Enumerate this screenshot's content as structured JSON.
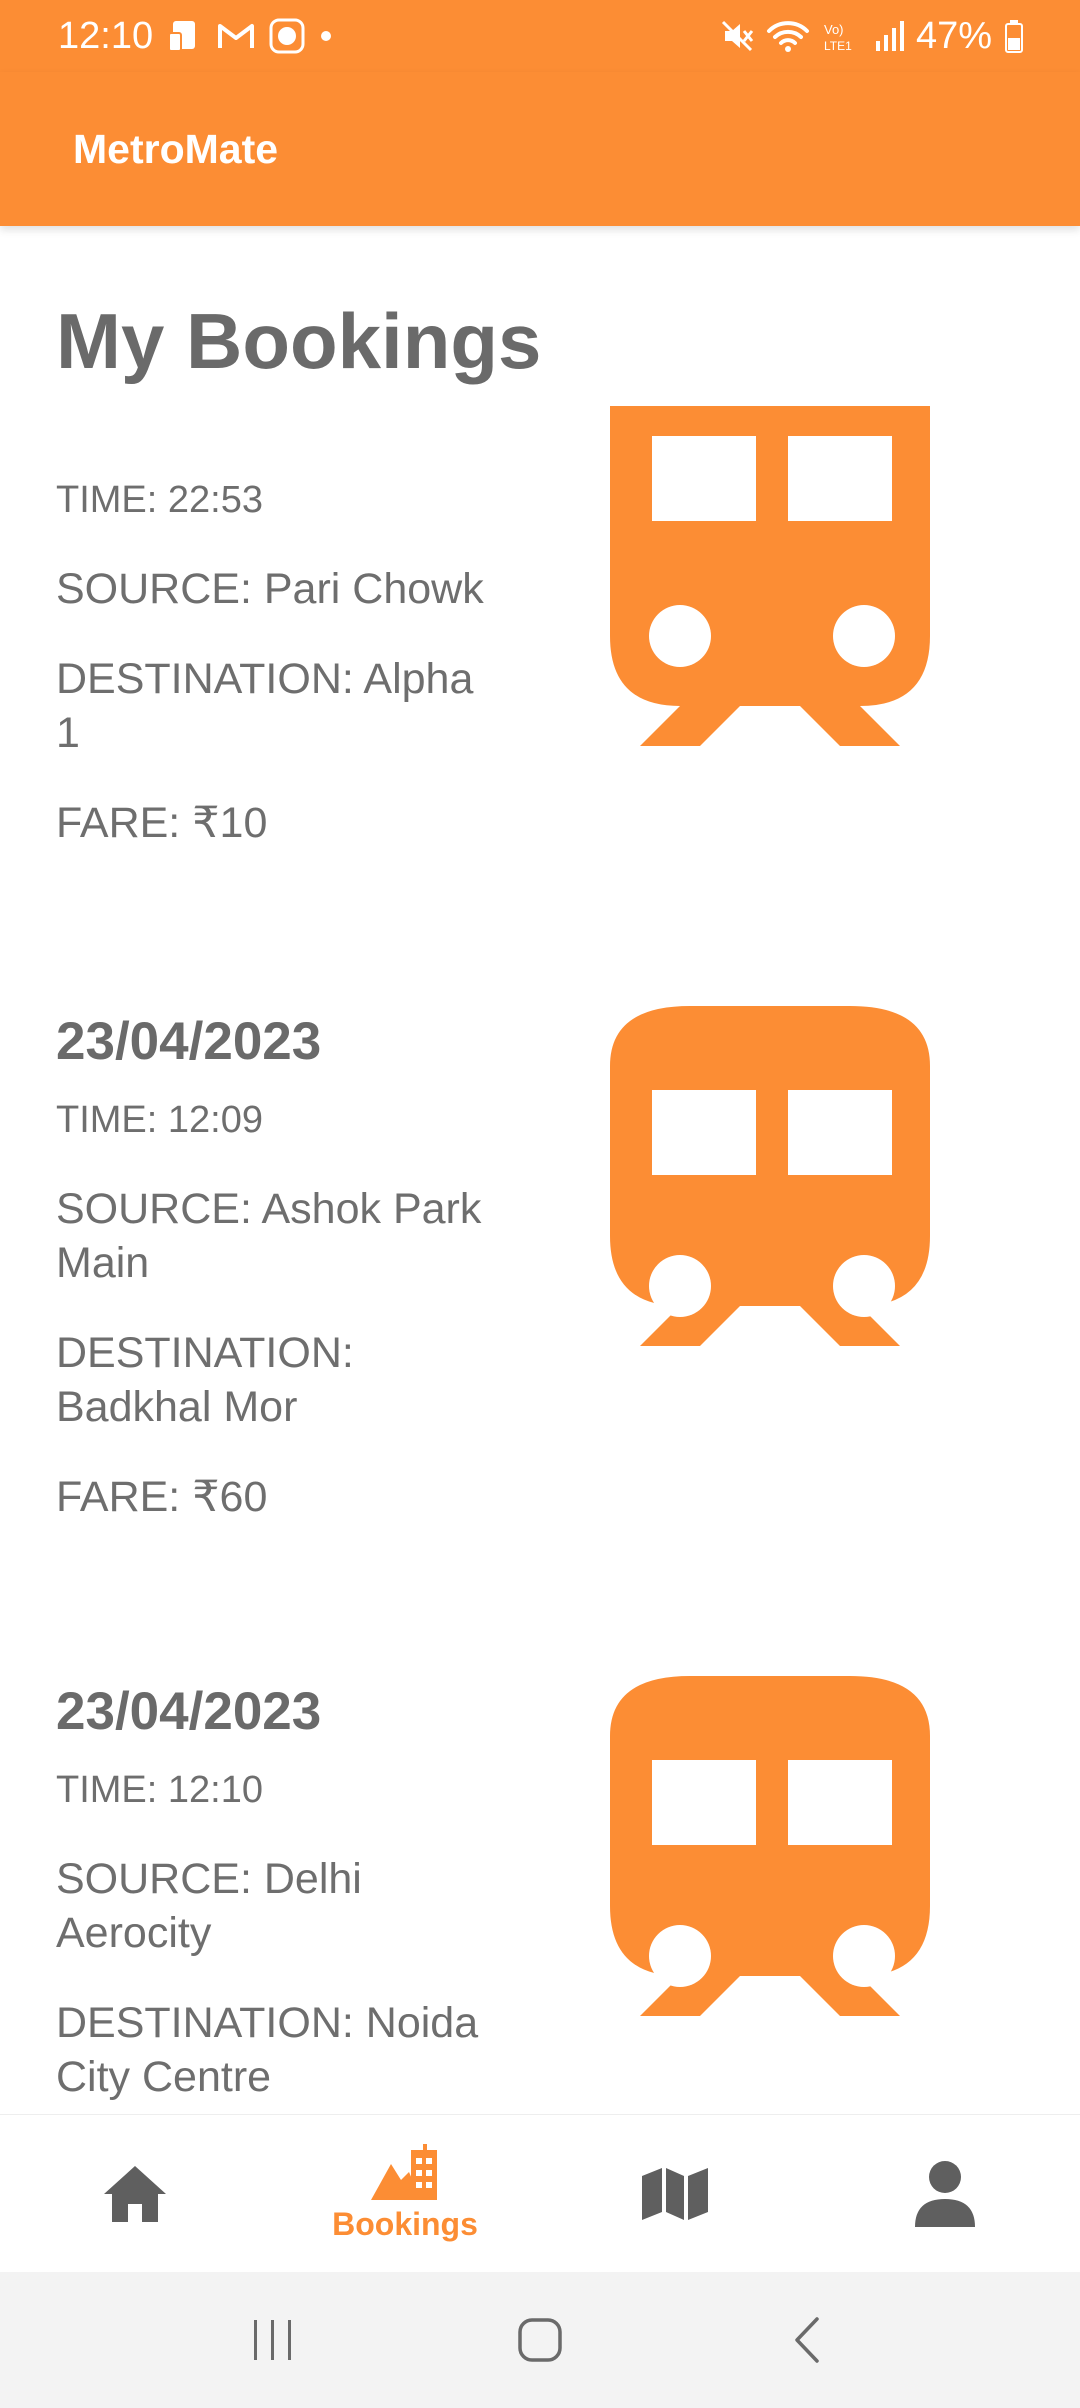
{
  "status_bar": {
    "time": "12:10",
    "battery": "47%",
    "icons": [
      "gallery-icon",
      "gmail-icon",
      "cb-app-icon",
      "notification-dot-icon",
      "mute-icon",
      "wifi-icon",
      "volte-icon",
      "signal-icon",
      "battery-icon"
    ]
  },
  "app_bar": {
    "title": "MetroMate"
  },
  "page": {
    "title": "My Bookings"
  },
  "bookings": [
    {
      "date": "",
      "time": "TIME: 22:53",
      "source": "SOURCE: Pari Chowk",
      "destination": "DESTINATION: Alpha 1",
      "fare": "FARE: ₹10",
      "icon": "train-icon"
    },
    {
      "date": "23/04/2023",
      "time": "TIME: 12:09",
      "source": "SOURCE: Ashok Park Main",
      "destination": "DESTINATION: Badkhal Mor",
      "fare": "FARE: ₹60",
      "icon": "train-icon"
    },
    {
      "date": "23/04/2023",
      "time": "TIME: 12:10",
      "source": "SOURCE: Delhi Aerocity",
      "destination": "DESTINATION: Noida City Centre",
      "fare": "",
      "icon": "train-icon"
    }
  ],
  "bottom_nav": {
    "items": [
      {
        "icon": "home-icon",
        "label": ""
      },
      {
        "icon": "bookings-icon",
        "label": "Bookings",
        "active": true
      },
      {
        "icon": "map-icon",
        "label": ""
      },
      {
        "icon": "profile-icon",
        "label": ""
      }
    ],
    "active_color": "#fc8d34",
    "inactive_color": "#5f5f5f"
  },
  "system_nav": {
    "buttons": [
      "recents-icon",
      "home-circle-icon",
      "back-icon"
    ]
  },
  "colors": {
    "accent": "#fc8d34",
    "text": "#6e6e6e",
    "background": "#ffffff"
  }
}
